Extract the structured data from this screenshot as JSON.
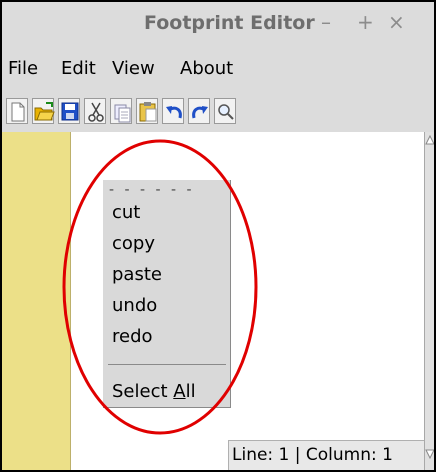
{
  "window": {
    "title": "Footprint Editor",
    "controls": {
      "minimize": "–",
      "maximize": "+",
      "close": "×"
    }
  },
  "menubar": [
    "File",
    "Edit",
    "View",
    "About"
  ],
  "toolbar": [
    "new-file-icon",
    "open-folder-icon",
    "save-icon",
    "cut-icon",
    "copy-icon",
    "paste-icon",
    "undo-icon",
    "redo-icon",
    "search-icon"
  ],
  "context_menu": {
    "tearoff": "- - - - - -",
    "items": [
      "cut",
      "copy",
      "paste",
      "undo",
      "redo"
    ],
    "select_all": {
      "pre": "Select ",
      "underlined": "A",
      "post": "ll"
    }
  },
  "status": "Line: 1 | Column: 1",
  "colors": {
    "gutter": "#ece088",
    "annotation_circle": "#e00000",
    "toolbar_icon_blue": "#1f4fc7",
    "folder_yellow": "#e9b200"
  }
}
